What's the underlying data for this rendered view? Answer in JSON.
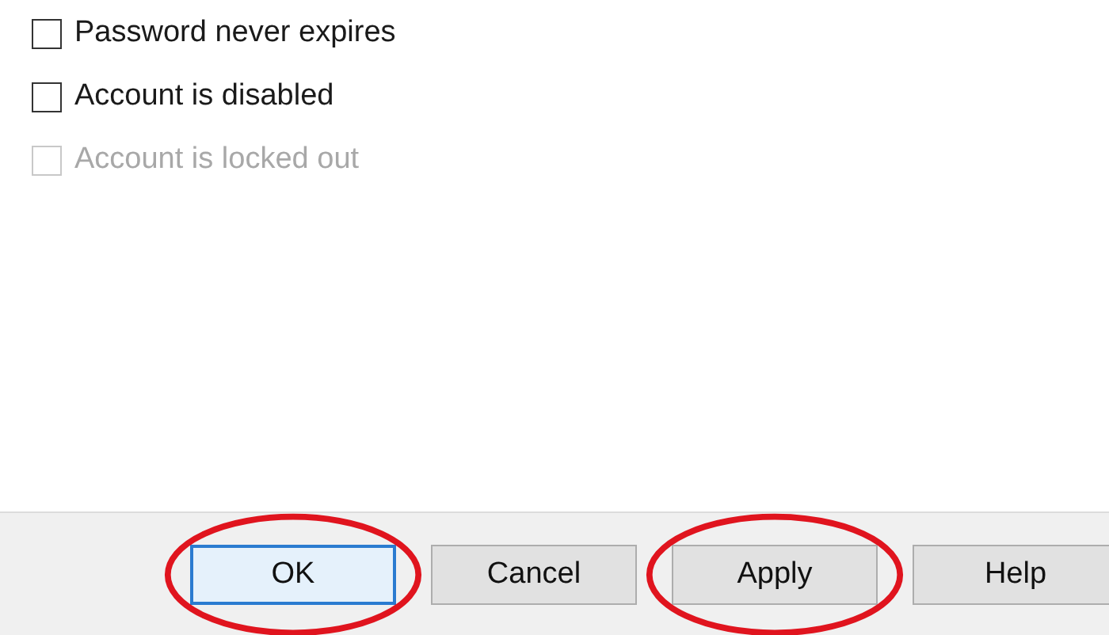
{
  "options": [
    {
      "label": "Password never expires",
      "checked": false,
      "disabled": false
    },
    {
      "label": "Account is disabled",
      "checked": false,
      "disabled": false
    },
    {
      "label": "Account is locked out",
      "checked": false,
      "disabled": true
    }
  ],
  "buttons": [
    {
      "label": "OK",
      "default": true,
      "circled": true
    },
    {
      "label": "Cancel",
      "default": false,
      "circled": false
    },
    {
      "label": "Apply",
      "default": false,
      "circled": true
    },
    {
      "label": "Help",
      "default": false,
      "circled": false
    }
  ]
}
